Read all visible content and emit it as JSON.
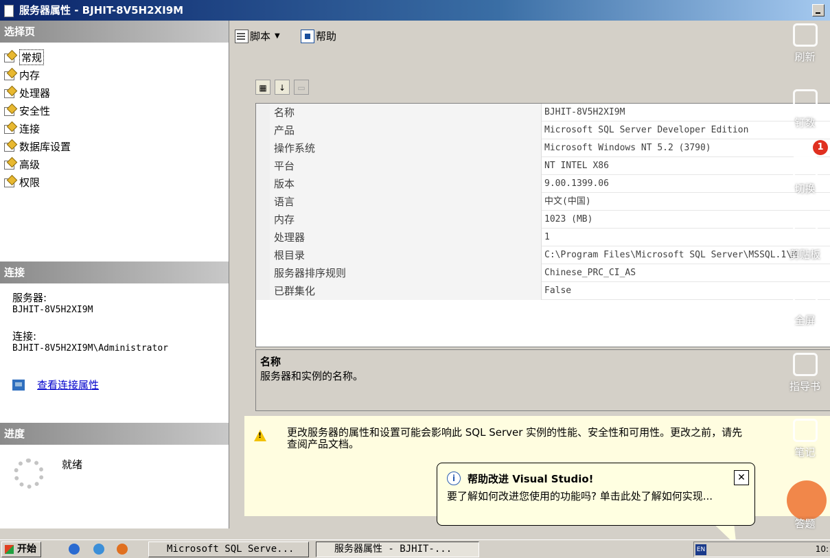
{
  "window": {
    "title": "服务器属性 - BJHIT-8V5H2XI9M"
  },
  "left": {
    "select_page_header": "选择页",
    "nav_items": [
      {
        "label": "常规"
      },
      {
        "label": "内存"
      },
      {
        "label": "处理器"
      },
      {
        "label": "安全性"
      },
      {
        "label": "连接"
      },
      {
        "label": "数据库设置"
      },
      {
        "label": "高级"
      },
      {
        "label": "权限"
      }
    ],
    "connection_header": "连接",
    "server_label": "服务器:",
    "server_value": "BJHIT-8V5H2XI9M",
    "connection_label": "连接:",
    "connection_value": "BJHIT-8V5H2XI9M\\Administrator",
    "view_conn_link": "查看连接属性",
    "progress_header": "进度",
    "status": "就绪"
  },
  "toolbar": {
    "script_label": "脚本",
    "help_label": "帮助"
  },
  "properties": [
    {
      "name": "名称",
      "value": "BJHIT-8V5H2XI9M"
    },
    {
      "name": "产品",
      "value": "Microsoft SQL Server Developer Edition"
    },
    {
      "name": "操作系统",
      "value": "Microsoft Windows NT 5.2 (3790)"
    },
    {
      "name": "平台",
      "value": "NT INTEL X86"
    },
    {
      "name": "版本",
      "value": "9.00.1399.06"
    },
    {
      "name": "语言",
      "value": "中文(中国)"
    },
    {
      "name": "内存",
      "value": "1023 (MB)"
    },
    {
      "name": "处理器",
      "value": "1"
    },
    {
      "name": "根目录",
      "value": "C:\\Program Files\\Microsoft SQL Server\\MSSQL.1\\M"
    },
    {
      "name": "服务器排序规则",
      "value": "Chinese_PRC_CI_AS"
    },
    {
      "name": "已群集化",
      "value": "False"
    }
  ],
  "description": {
    "title": "名称",
    "text": "服务器和实例的名称。"
  },
  "warning": {
    "line1": "更改服务器的属性和设置可能会影响此 SQL Server 实例的性能、安全性和可用性。更改之前，请先",
    "line2": "查阅产品文档。"
  },
  "balloon": {
    "title": "帮助改进 Visual Studio!",
    "body": "要了解如何改进您使用的功能吗? 单击此处了解如何实现..."
  },
  "sidebar_overlay": {
    "items": [
      "刷新",
      "钉数",
      "切换",
      "剪贴板",
      "全屏",
      "指导书",
      "笔记",
      "答题"
    ],
    "badge": "1"
  },
  "taskbar": {
    "start": "开始",
    "task1": "Microsoft SQL Serve...",
    "task2": "服务器属性 - BJHIT-...",
    "lang": "EN",
    "clock": "10:"
  }
}
